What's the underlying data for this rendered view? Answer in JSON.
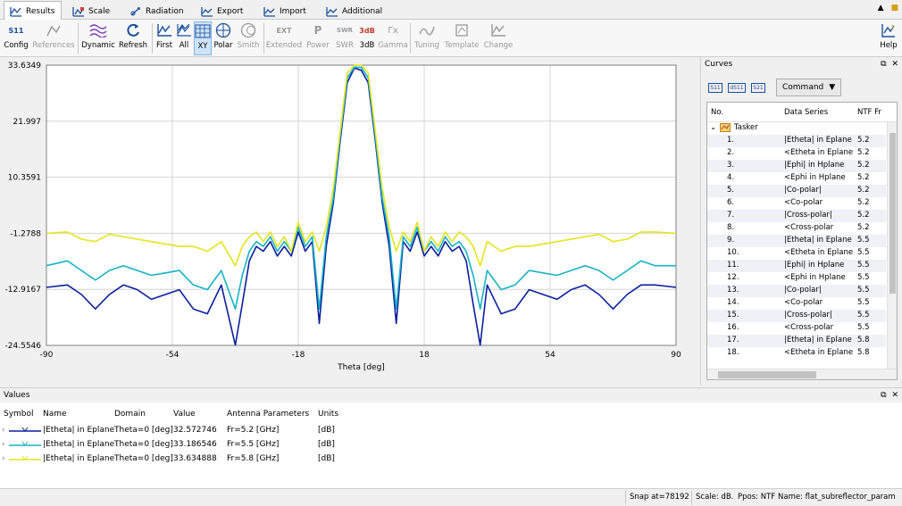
{
  "tabs": [
    {
      "label": "Results",
      "icon": "results-icon"
    },
    {
      "label": "Scale",
      "icon": "scale-icon"
    },
    {
      "label": "Radiation",
      "icon": "radiation-icon"
    },
    {
      "label": "Export",
      "icon": "export-icon"
    },
    {
      "label": "Import",
      "icon": "import-icon"
    },
    {
      "label": "Additional",
      "icon": "additional-icon"
    }
  ],
  "toolbar": {
    "config": "Config",
    "references": "References",
    "dynamic": "Dynamic",
    "refresh": "Refresh",
    "first": "First",
    "all": "All",
    "xy": "XY",
    "polar": "Polar",
    "smith": "Smith",
    "extended": "Extended",
    "power": "Power",
    "swr": "SWR",
    "db3": "3dB",
    "gamma": "Gamma",
    "tuning": "Tuning",
    "template": "Template",
    "change": "Change",
    "help": "Help",
    "icon_texts": {
      "config": "S11",
      "extended": "EXT",
      "power": "P",
      "swr": "SWR",
      "db3": "3dB",
      "gamma": "Γx"
    }
  },
  "chart_data": {
    "type": "line",
    "xlabel": "Theta [deg]",
    "ylabel": "",
    "xlim": [
      -90,
      90
    ],
    "ylim": [
      -24.5546,
      33.6349
    ],
    "xticks": [
      "-90",
      "-54",
      "-18",
      "18",
      "54",
      "90"
    ],
    "yticks": [
      "33.6349",
      "21.997",
      "10.3591",
      "-1.2788",
      "-12.9167",
      "-24.5546"
    ],
    "grid": true,
    "series": [
      {
        "color": "#0b1f9e",
        "x": [
          -90,
          -84,
          -80,
          -76,
          -72,
          -68,
          -64,
          -60,
          -56,
          -52,
          -48,
          -44,
          -40,
          -36,
          -34,
          -32,
          -30,
          -28,
          -26,
          -24,
          -22,
          -20,
          -18,
          -16,
          -14,
          -12,
          -10,
          -8,
          -6,
          -4,
          -2,
          0,
          2,
          4,
          6,
          8,
          10,
          12,
          14,
          16,
          18,
          20,
          22,
          24,
          26,
          28,
          30,
          32,
          34,
          36,
          40,
          44,
          48,
          52,
          56,
          60,
          64,
          68,
          72,
          76,
          80,
          84,
          90
        ],
        "y": [
          -12.5,
          -12,
          -14,
          -17,
          -14,
          -12,
          -13,
          -15,
          -14,
          -13,
          -17,
          -18,
          -12,
          -24.5,
          -16,
          -7,
          -4,
          -5,
          -3,
          -6,
          -4,
          -6,
          -1,
          -5,
          -3,
          -20,
          -4,
          5,
          18,
          30,
          33,
          32.57,
          30,
          18,
          5,
          -4,
          -20,
          -3,
          -5,
          -1,
          -6,
          -4,
          -6,
          -3,
          -5,
          -4,
          -7,
          -16,
          -24.5,
          -12,
          -18,
          -17,
          -13,
          -14,
          -15,
          -13,
          -12,
          -14,
          -17,
          -14,
          -12,
          -12,
          -12.5
        ]
      },
      {
        "color": "#17b3c4",
        "x": [
          -90,
          -84,
          -80,
          -76,
          -72,
          -68,
          -64,
          -60,
          -56,
          -52,
          -48,
          -44,
          -40,
          -36,
          -34,
          -32,
          -30,
          -28,
          -26,
          -24,
          -22,
          -20,
          -18,
          -16,
          -14,
          -12,
          -10,
          -8,
          -6,
          -4,
          -2,
          0,
          2,
          4,
          6,
          8,
          10,
          12,
          14,
          16,
          18,
          20,
          22,
          24,
          26,
          28,
          30,
          32,
          34,
          36,
          40,
          44,
          48,
          52,
          56,
          60,
          64,
          68,
          72,
          76,
          80,
          84,
          90
        ],
        "y": [
          -8,
          -7,
          -9,
          -11,
          -9,
          -8,
          -9,
          -10,
          -9.5,
          -9,
          -12,
          -13,
          -9,
          -17,
          -10,
          -5,
          -3,
          -4,
          -2,
          -5,
          -3,
          -5,
          0,
          -4,
          -2,
          -17,
          -2,
          6,
          19,
          31,
          33.2,
          33.19,
          31,
          19,
          6,
          -2,
          -17,
          -2,
          -4,
          0,
          -5,
          -3,
          -5,
          -2,
          -4,
          -3,
          -5,
          -10,
          -17,
          -9,
          -13,
          -12,
          -9,
          -9.5,
          -10,
          -9,
          -8,
          -9,
          -11,
          -9,
          -7,
          -8,
          -8
        ]
      },
      {
        "color": "#e4e41d",
        "x": [
          -90,
          -84,
          -80,
          -76,
          -72,
          -68,
          -64,
          -60,
          -56,
          -52,
          -48,
          -44,
          -40,
          -36,
          -34,
          -32,
          -30,
          -28,
          -26,
          -24,
          -22,
          -20,
          -18,
          -16,
          -14,
          -12,
          -10,
          -8,
          -6,
          -4,
          -2,
          0,
          2,
          4,
          6,
          8,
          10,
          12,
          14,
          16,
          18,
          20,
          22,
          24,
          26,
          28,
          30,
          32,
          34,
          36,
          40,
          44,
          48,
          52,
          56,
          60,
          64,
          68,
          72,
          76,
          80,
          84,
          90
        ],
        "y": [
          -1.3,
          -1,
          -2.5,
          -3,
          -1.5,
          -2,
          -2.5,
          -3,
          -3.5,
          -4,
          -4,
          -5,
          -3,
          -8,
          -4,
          -2,
          -1,
          -3,
          -1,
          -4,
          -2,
          -5,
          1,
          -3,
          -1,
          -5,
          0,
          8,
          20,
          32,
          33.6,
          33.63,
          32,
          20,
          8,
          0,
          -5,
          -1,
          -3,
          1,
          -5,
          -2,
          -4,
          -1,
          -3,
          -1,
          -2,
          -4,
          -8,
          -3,
          -5,
          -4,
          -4,
          -3.5,
          -3,
          -2.5,
          -2,
          -1.5,
          -3,
          -2.5,
          -1,
          -1,
          -1.3
        ]
      }
    ]
  },
  "curves_panel": {
    "title": "Curves",
    "command": "Command",
    "tool_icons": [
      "S11",
      "dS11",
      "S21"
    ],
    "columns": [
      "No.",
      "Data Series",
      "NTF Fr"
    ],
    "group": "Tasker",
    "rows": [
      {
        "no": "1.",
        "series": "|Etheta| in Eplane",
        "fr": "5.2"
      },
      {
        "no": "2.",
        "series": "<Etheta in Eplane",
        "fr": "5.2"
      },
      {
        "no": "3.",
        "series": "|Ephi| in Hplane",
        "fr": "5.2"
      },
      {
        "no": "4.",
        "series": "<Ephi in Hplane",
        "fr": "5.2"
      },
      {
        "no": "5.",
        "series": "|Co-polar|",
        "fr": "5.2"
      },
      {
        "no": "6.",
        "series": "<Co-polar",
        "fr": "5.2"
      },
      {
        "no": "7.",
        "series": "|Cross-polar|",
        "fr": "5.2"
      },
      {
        "no": "8.",
        "series": "<Cross-polar",
        "fr": "5.2"
      },
      {
        "no": "9.",
        "series": "|Etheta| in Eplane",
        "fr": "5.5"
      },
      {
        "no": "10.",
        "series": "<Etheta in Eplane",
        "fr": "5.5"
      },
      {
        "no": "11.",
        "series": "|Ephi| in Hplane",
        "fr": "5.5"
      },
      {
        "no": "12.",
        "series": "<Ephi in Hplane",
        "fr": "5.5"
      },
      {
        "no": "13.",
        "series": "|Co-polar|",
        "fr": "5.5"
      },
      {
        "no": "14.",
        "series": "<Co-polar",
        "fr": "5.5"
      },
      {
        "no": "15.",
        "series": "|Cross-polar|",
        "fr": "5.5"
      },
      {
        "no": "16.",
        "series": "<Cross-polar",
        "fr": "5.5"
      },
      {
        "no": "17.",
        "series": "|Etheta| in Eplane",
        "fr": "5.8"
      },
      {
        "no": "18.",
        "series": "<Etheta in Eplane",
        "fr": "5.8"
      }
    ]
  },
  "values_panel": {
    "title": "Values",
    "columns": [
      "Symbol",
      "Name",
      "Domain",
      "Value",
      "Antenna Parameters",
      "Units"
    ],
    "rows": [
      {
        "color": "#0b1f9e",
        "name": "|Etheta| in Eplane",
        "domain": "Theta=0 [deg]",
        "value": "32.572746",
        "params": "Fr=5.2 [GHz]",
        "units": "[dB]"
      },
      {
        "color": "#17b3c4",
        "name": "|Etheta| in Eplane",
        "domain": "Theta=0 [deg]",
        "value": "33.186546",
        "params": "Fr=5.5 [GHz]",
        "units": "[dB]"
      },
      {
        "color": "#e4e41d",
        "name": "|Etheta| in Eplane",
        "domain": "Theta=0 [deg]",
        "value": "33.634888",
        "params": "Fr=5.8 [GHz]",
        "units": "[dB]"
      }
    ]
  },
  "status": {
    "snap": "Snap at=78192",
    "scale": "Scale: dB.",
    "ppos": "Ppos: NTF",
    "name": "Name: flat_subreflector_param"
  }
}
